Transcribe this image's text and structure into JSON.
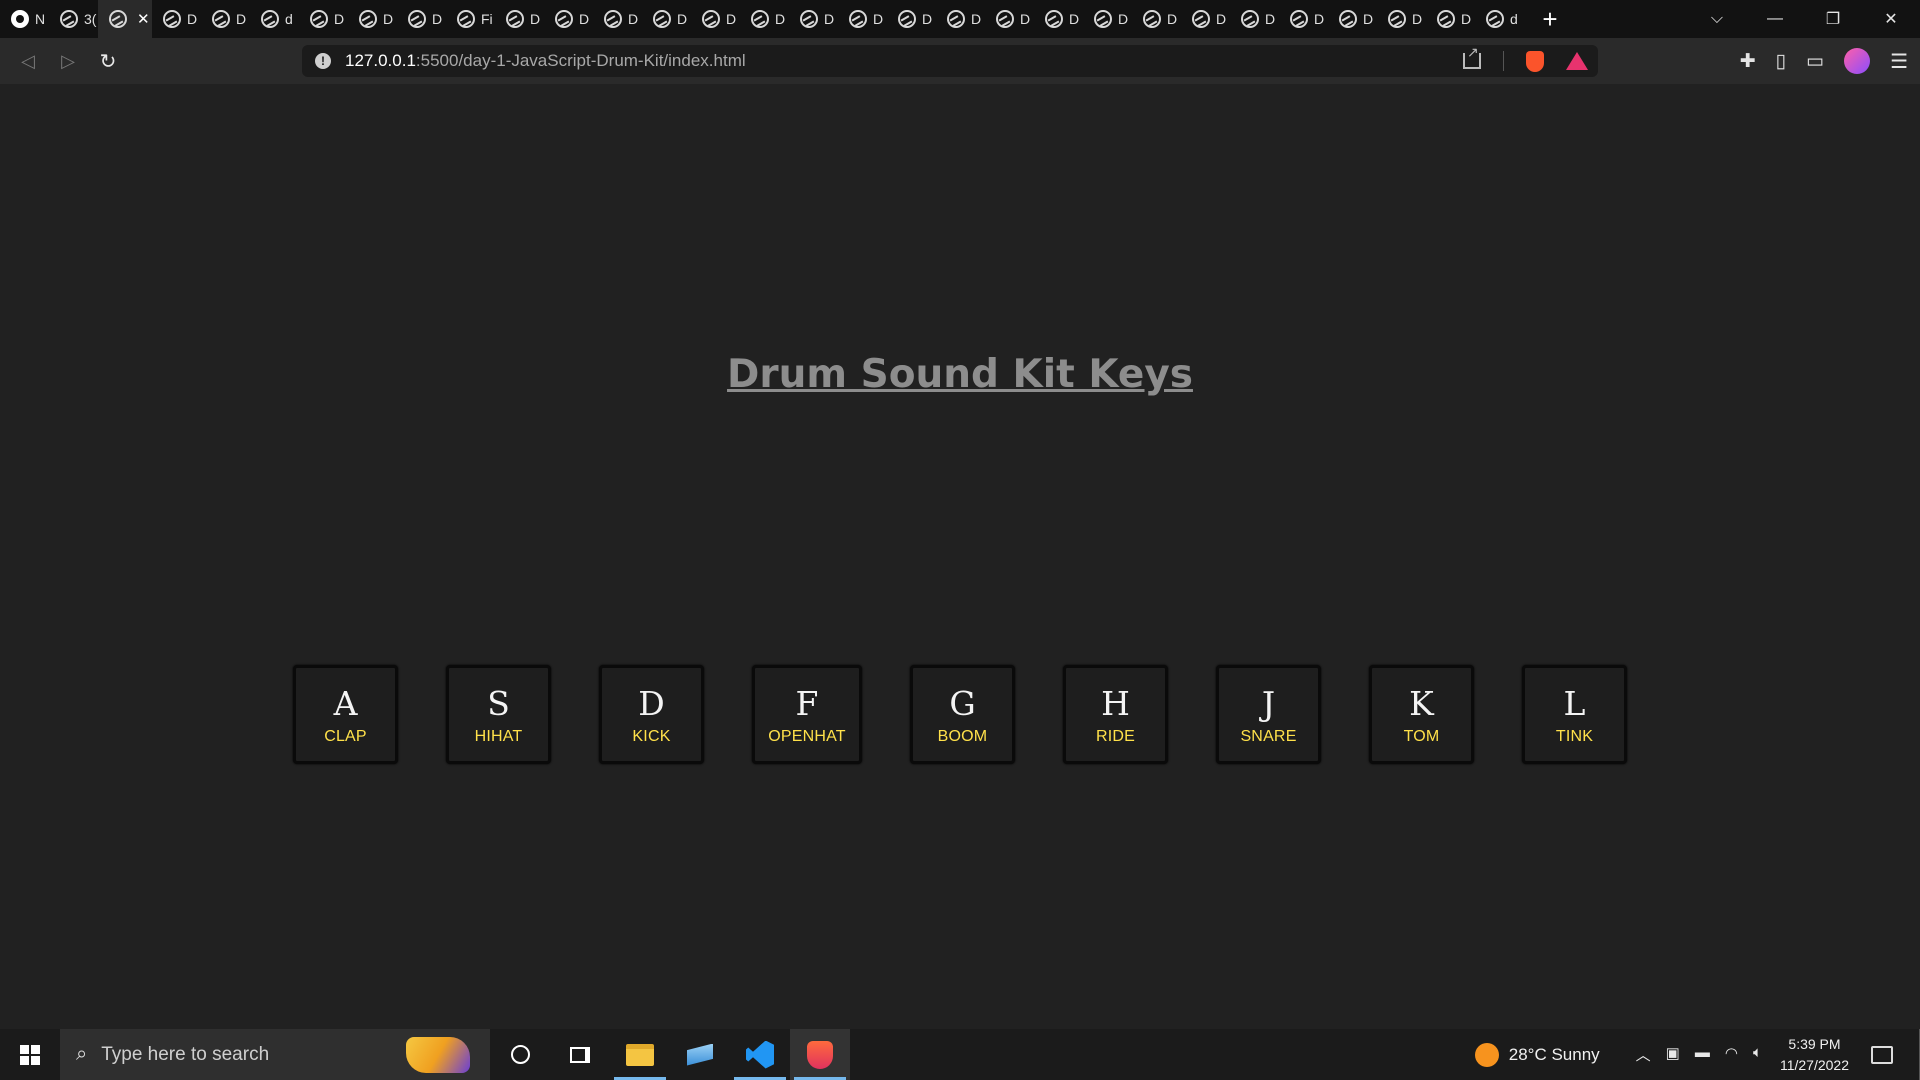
{
  "browser": {
    "tabs": [
      {
        "label": "N",
        "icon": "github-icon"
      },
      {
        "label": "3(",
        "icon": "globe-icon"
      },
      {
        "label": "",
        "icon": "globe-icon",
        "active": true
      },
      {
        "label": "D",
        "icon": "globe-icon"
      },
      {
        "label": "D",
        "icon": "globe-icon"
      },
      {
        "label": "d",
        "icon": "globe-icon"
      },
      {
        "label": "D",
        "icon": "globe-icon"
      },
      {
        "label": "D",
        "icon": "globe-icon"
      },
      {
        "label": "D",
        "icon": "globe-icon"
      },
      {
        "label": "Fi",
        "icon": "globe-icon"
      },
      {
        "label": "D",
        "icon": "globe-icon"
      },
      {
        "label": "D",
        "icon": "globe-icon"
      },
      {
        "label": "D",
        "icon": "globe-icon"
      },
      {
        "label": "D",
        "icon": "globe-icon"
      },
      {
        "label": "D",
        "icon": "globe-icon"
      },
      {
        "label": "D",
        "icon": "globe-icon"
      },
      {
        "label": "D",
        "icon": "globe-icon"
      },
      {
        "label": "D",
        "icon": "globe-icon"
      },
      {
        "label": "D",
        "icon": "globe-icon"
      },
      {
        "label": "D",
        "icon": "globe-icon"
      },
      {
        "label": "D",
        "icon": "globe-icon"
      },
      {
        "label": "D",
        "icon": "globe-icon"
      },
      {
        "label": "D",
        "icon": "globe-icon"
      },
      {
        "label": "D",
        "icon": "globe-icon"
      },
      {
        "label": "D",
        "icon": "globe-icon"
      },
      {
        "label": "D",
        "icon": "globe-icon"
      },
      {
        "label": "D",
        "icon": "globe-icon"
      },
      {
        "label": "D",
        "icon": "globe-icon"
      },
      {
        "label": "D",
        "icon": "globe-icon"
      },
      {
        "label": "D",
        "icon": "globe-icon"
      },
      {
        "label": "d",
        "icon": "globe-icon"
      }
    ],
    "active_tab_close": "✕",
    "new_tab": "+",
    "window_controls": {
      "dropdown": "⌵",
      "minimize": "—",
      "restore": "❐",
      "close": "✕"
    },
    "url": {
      "host": "127.0.0.1",
      "path": ":5500/day-1-JavaScript-Drum-Kit/index.html"
    }
  },
  "page": {
    "title": "Drum Sound Kit Keys",
    "keys": [
      {
        "key": "A",
        "sound": "CLAP"
      },
      {
        "key": "S",
        "sound": "HIHAT"
      },
      {
        "key": "D",
        "sound": "KICK"
      },
      {
        "key": "F",
        "sound": "OPENHAT"
      },
      {
        "key": "G",
        "sound": "BOOM"
      },
      {
        "key": "H",
        "sound": "RIDE"
      },
      {
        "key": "J",
        "sound": "SNARE"
      },
      {
        "key": "K",
        "sound": "TOM"
      },
      {
        "key": "L",
        "sound": "TINK"
      }
    ]
  },
  "taskbar": {
    "search_placeholder": "Type here to search",
    "weather": "28°C  Sunny",
    "time": "5:39 PM",
    "date": "11/27/2022"
  },
  "colors": {
    "background": "#212121",
    "title": "#8d8d8d",
    "sound_label": "#ffe14a",
    "key_letter": "#f4f4f4"
  }
}
